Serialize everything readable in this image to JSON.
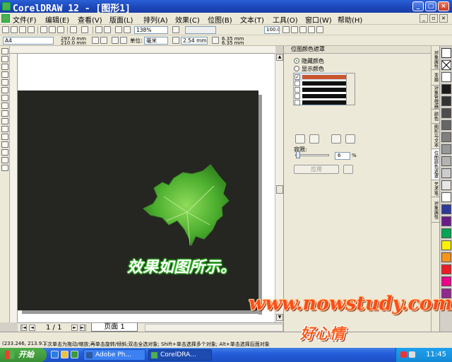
{
  "window": {
    "title": "CorelDRAW 12 - [图形1]",
    "controls": [
      "_",
      "□",
      "×"
    ]
  },
  "menu": {
    "items": [
      "文件(F)",
      "编辑(E)",
      "查看(V)",
      "版面(L)",
      "排列(A)",
      "效果(C)",
      "位图(B)",
      "文本(T)",
      "工具(O)",
      "窗口(W)",
      "帮助(H)"
    ]
  },
  "toolbar": {
    "zoom": "138%",
    "snap_value": "100.0"
  },
  "property_bar": {
    "paper": "A4",
    "width": "297.0 mm",
    "height": "210.0 mm",
    "units_label": "单位:",
    "units_value": "毫米",
    "nudge": "2.54 mm",
    "dup_x": "6.35 mm",
    "dup_y": "6.35 mm"
  },
  "docker": {
    "title": "位图颜色遮罩",
    "hide_label": "隐藏颜色",
    "show_label": "显示颜色",
    "selected_mode": "hide",
    "colors": [
      {
        "checked": "✓",
        "color": "#c8552d",
        "value": "6"
      },
      {
        "checked": "",
        "color": "#111111",
        "value": "0"
      },
      {
        "checked": "",
        "color": "#111111",
        "value": "0"
      },
      {
        "checked": "",
        "color": "#111111",
        "value": "0"
      },
      {
        "checked": "",
        "color": "#111111",
        "value": "0"
      }
    ],
    "tolerance_label": "容限:",
    "tolerance_value": "6",
    "tolerance_unit": "%",
    "apply_label": "应用"
  },
  "side_tabs": [
    "对象属性",
    "变换",
    "对象管理器",
    "颜色",
    "图形与文本",
    "位图颜色遮罩",
    "艺术笔",
    "对象属性"
  ],
  "palette": [
    "#ffffff",
    "#1a1a1a",
    "#333333",
    "#4d4d4d",
    "#666666",
    "#808080",
    "#999999",
    "#b3b3b3",
    "#cccccc",
    "#e6e6e6",
    "#ffffff",
    "#2b3a9a",
    "#6a1b8a",
    "#00a651",
    "#fff200",
    "#f7941d",
    "#ed1c24",
    "#ec008c",
    "#92278f"
  ],
  "canvas": {
    "caption": "效果如图所示。"
  },
  "page_nav": {
    "count": "1 / 1",
    "tab": "页面 1"
  },
  "status": {
    "coords": "(233.246, 213.9...",
    "hint": "下次单击为拖动/缩放;再单击旋转/倾斜;双击全选对象; Shift+单击选择多个对象; Alt+单击选择后面对象"
  },
  "watermark": {
    "site": "www.nowstudy.com",
    "author": "好心情"
  },
  "taskbar": {
    "start": "开始",
    "tasks": [
      "Adobe Ph...",
      "CorelDRA..."
    ],
    "clock": "11:45"
  }
}
